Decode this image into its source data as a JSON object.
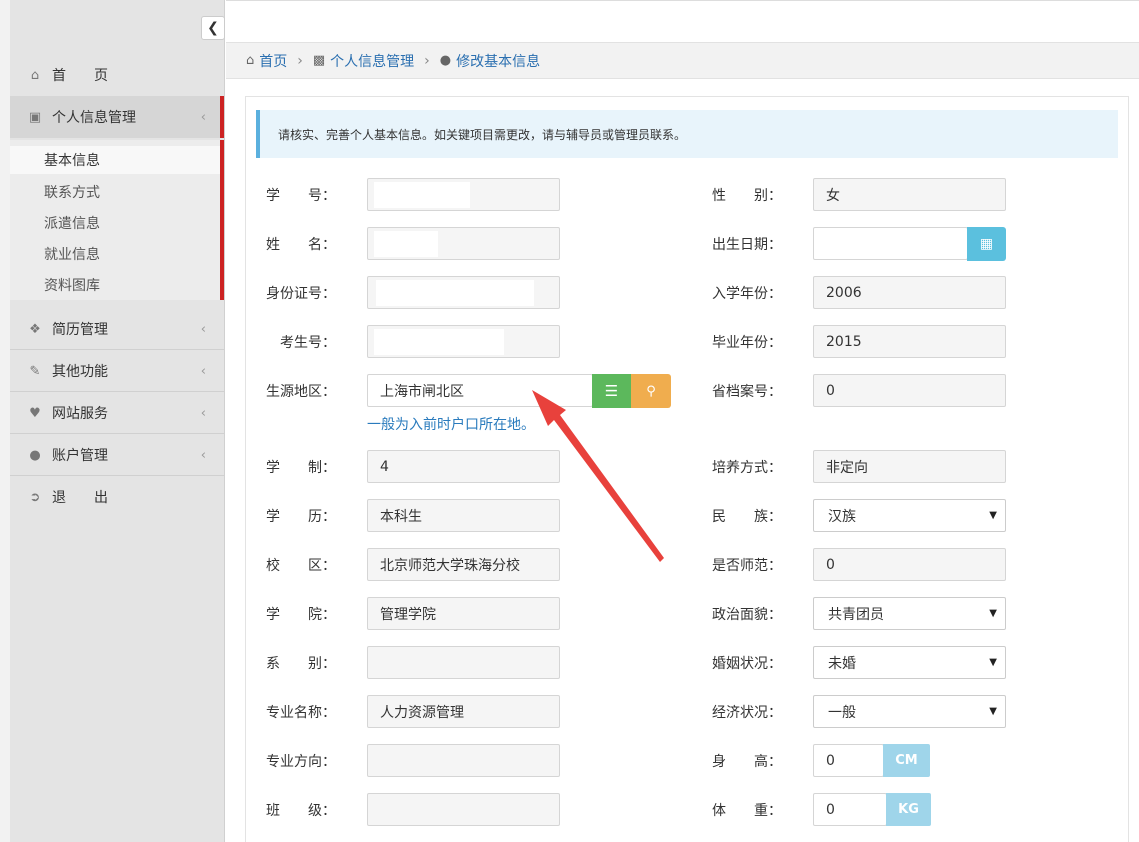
{
  "sidebar": {
    "nav": [
      {
        "label": "首　　页",
        "icon": "home-icon"
      },
      {
        "label": "个人信息管理",
        "icon": "monitor-icon"
      },
      {
        "label": "简历管理",
        "icon": "puzzle-icon"
      },
      {
        "label": "其他功能",
        "icon": "edit-icon"
      },
      {
        "label": "网站服务",
        "icon": "heart-icon"
      },
      {
        "label": "账户管理",
        "icon": "user-icon"
      },
      {
        "label": "退　　出",
        "icon": "logout-icon"
      }
    ],
    "sub": [
      "基本信息",
      "联系方式",
      "派遣信息",
      "就业信息",
      "资料图库"
    ]
  },
  "breadcrumb": [
    "首页",
    "个人信息管理",
    "修改基本信息"
  ],
  "notice": "请核实、完善个人基本信息。如关键项目需更改，请与辅导员或管理员联系。",
  "left_form": [
    {
      "label": "学　　号：",
      "value": ""
    },
    {
      "label": "姓　　名：",
      "value": ""
    },
    {
      "label": "身份证号：",
      "value": ""
    },
    {
      "label": "考生号：",
      "value": ""
    },
    {
      "label": "生源地区：",
      "value": "上海市闸北区"
    },
    {
      "label": "学　　制：",
      "value": "4"
    },
    {
      "label": "学　　历：",
      "value": "本科生"
    },
    {
      "label": "校　　区：",
      "value": "北京师范大学珠海分校"
    },
    {
      "label": "学　　院：",
      "value": "管理学院"
    },
    {
      "label": "系　　别：",
      "value": ""
    },
    {
      "label": "专业名称：",
      "value": "人力资源管理"
    },
    {
      "label": "专业方向：",
      "value": ""
    },
    {
      "label": "班　　级：",
      "value": ""
    }
  ],
  "right_form": [
    {
      "label": "性　　别：",
      "value": "女"
    },
    {
      "label": "出生日期：",
      "value": ""
    },
    {
      "label": "入学年份：",
      "value": "2006"
    },
    {
      "label": "毕业年份：",
      "value": "2015"
    },
    {
      "label": "省档案号：",
      "value": "0"
    },
    {
      "label": "培养方式：",
      "value": "非定向"
    },
    {
      "label": "民　　族：",
      "value": "汉族"
    },
    {
      "label": "是否师范：",
      "value": "0"
    },
    {
      "label": "政治面貌：",
      "value": "共青团员"
    },
    {
      "label": "婚姻状况：",
      "value": "未婚"
    },
    {
      "label": "经济状况：",
      "value": "一般"
    },
    {
      "label": "身　　高：",
      "value": "0"
    },
    {
      "label": "体　　重：",
      "value": "0"
    }
  ],
  "hint": "一般为入前时户口所在地。",
  "units": {
    "height": "CM",
    "weight": "KG"
  },
  "colors": {
    "accent_red": "#cc2222",
    "btn_green": "#5cb85c",
    "btn_orange": "#f0ad4e",
    "calendar_blue": "#5bc0de",
    "link_blue": "#2a7bbd"
  }
}
